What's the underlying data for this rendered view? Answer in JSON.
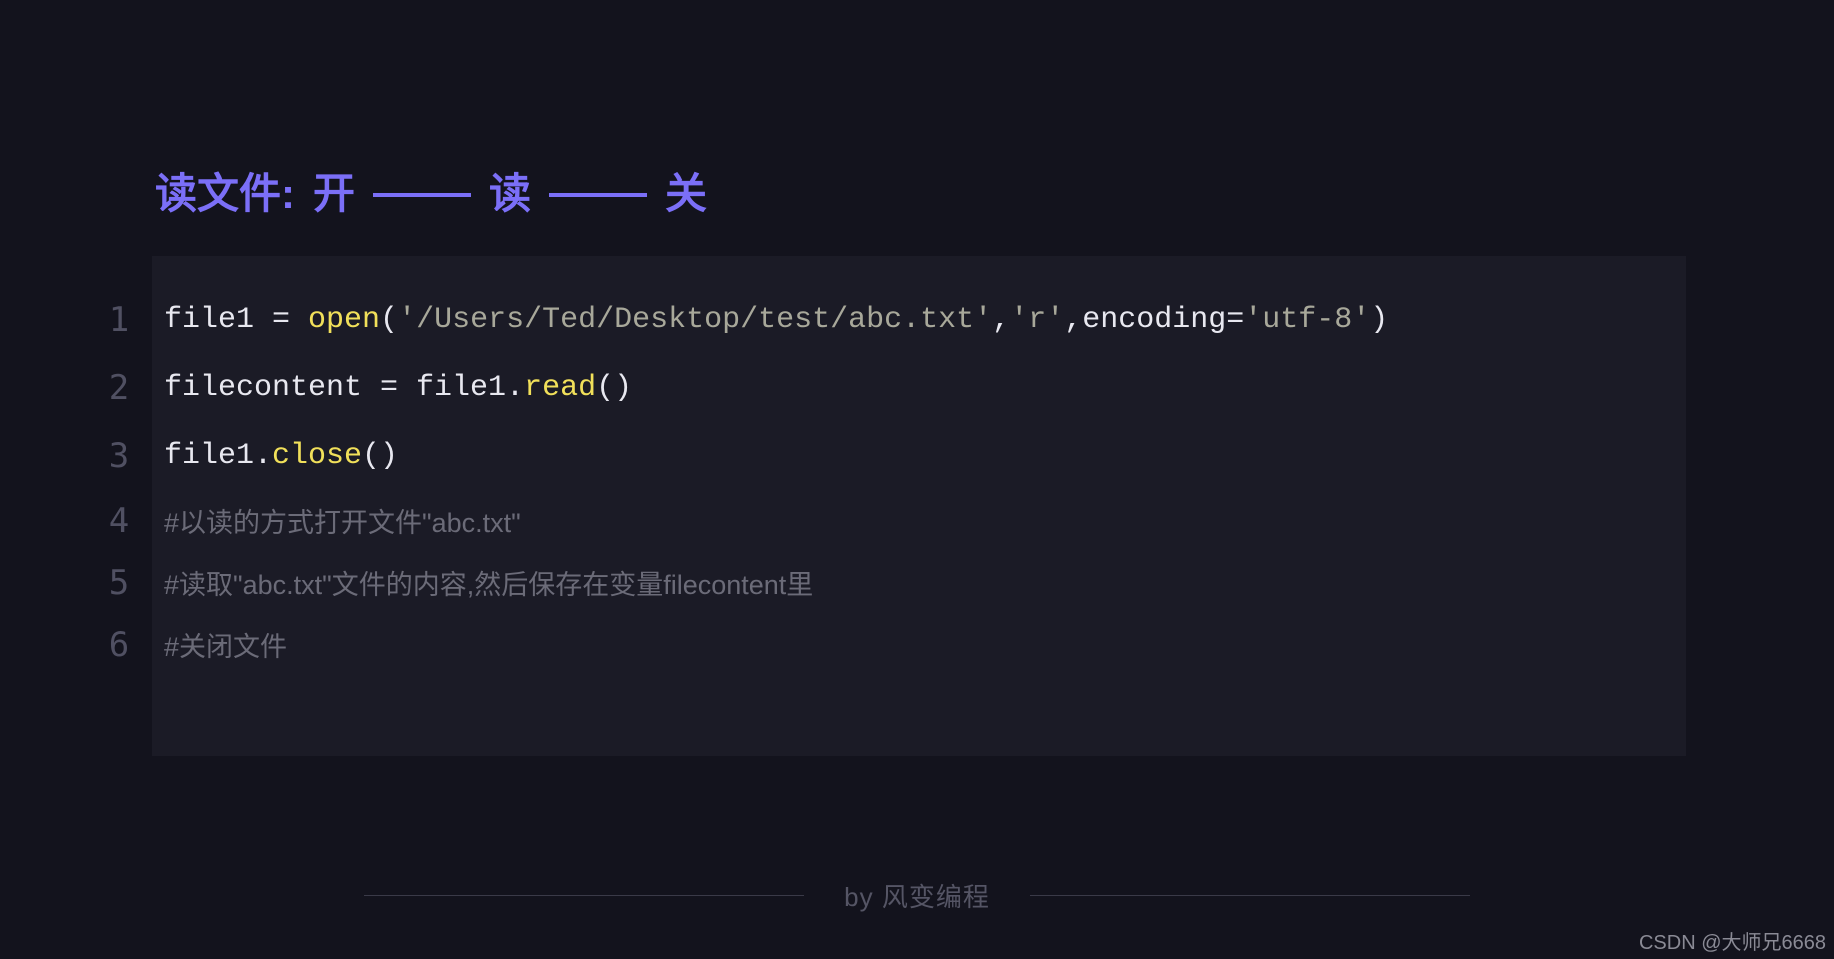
{
  "title": {
    "label": "读文件:",
    "step1": "开",
    "step2": "读",
    "step3": "关"
  },
  "code": {
    "line1": {
      "num": "1",
      "t1": "file1 = ",
      "fn": "open",
      "t2": "(",
      "s1": "'/Users/Ted/Desktop/test/abc.txt'",
      "t3": ",",
      "s2": "'r'",
      "t4": ",encoding=",
      "s3": "'utf-8'",
      "t5": ")"
    },
    "line2": {
      "num": "2",
      "t1": "filecontent = file1.",
      "fn": "read",
      "t2": "()"
    },
    "line3": {
      "num": "3",
      "t1": "file1.",
      "fn": "close",
      "t2": "()"
    },
    "line4": {
      "num": "4",
      "comment": "#以读的方式打开文件\"abc.txt\""
    },
    "line5": {
      "num": "5",
      "comment": "#读取\"abc.txt\"文件的内容,然后保存在变量filecontent里"
    },
    "line6": {
      "num": "6",
      "comment": "#关闭文件"
    }
  },
  "footer": "by 风变编程",
  "watermark": "CSDN @大师兄6668"
}
